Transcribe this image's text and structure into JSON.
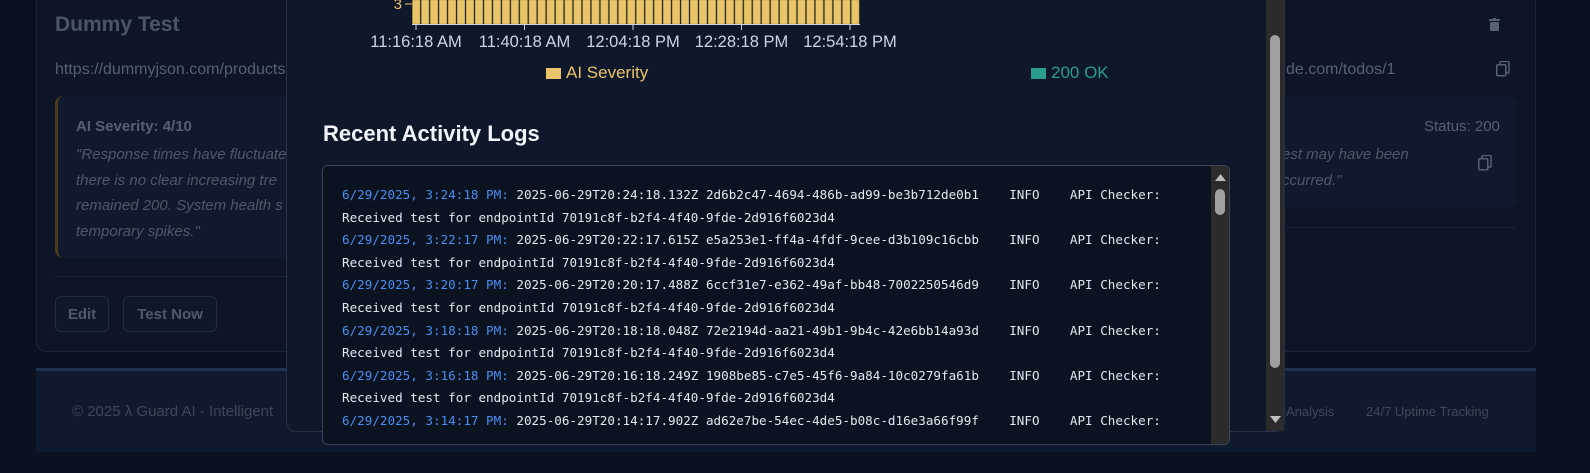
{
  "background": {
    "card_title": "Dummy Test",
    "url_left": "https://dummyjson.com/products",
    "url_right": "de.com/todos/1",
    "analysis_left": {
      "severity_label": "AI Severity: 4/10",
      "quote_lines": [
        "\"Response times have fluctuate",
        "there is no clear increasing tre",
        "remained 200. System health s",
        "temporary spikes.\""
      ]
    },
    "analysis_right": {
      "status_label": "Status: 200",
      "quote_lines": [
        "est may have been",
        "ccurred.\""
      ]
    },
    "buttons": {
      "edit": "Edit",
      "test_now": "Test Now"
    },
    "footer": {
      "left_text": "© 2025 λ Guard AI - Intelligent",
      "right_items": [
        "Analysis",
        "24/7 Uptime Tracking"
      ]
    }
  },
  "modal": {
    "chart_data": {
      "type": "bar",
      "x_tick_labels": [
        "11:16:18 AM",
        "11:40:18 AM",
        "12:04:18 PM",
        "12:28:18 PM",
        "12:54:18 PM"
      ],
      "y_visible_tick": "3",
      "series": [
        {
          "name": "AI Severity",
          "color": "#e9c46a",
          "bar_count": 50
        },
        {
          "name": "200 OK",
          "color": "#2a9d8f"
        }
      ],
      "legend": "bottom"
    },
    "logs_title": "Recent Activity Logs",
    "logs": [
      {
        "timestamp": "6/29/2025, 3:24:18 PM:",
        "iso": "2025-06-29T20:24:18.132Z",
        "id": "2d6b2c47-4694-486b-ad99-be3b712de0b1",
        "level": "INFO",
        "source": "API Checker:",
        "message": "Received test for endpointId 70191c8f-b2f4-4f40-9fde-2d916f6023d4"
      },
      {
        "timestamp": "6/29/2025, 3:22:17 PM:",
        "iso": "2025-06-29T20:22:17.615Z",
        "id": "e5a253e1-ff4a-4fdf-9cee-d3b109c16cbb",
        "level": "INFO",
        "source": "API Checker:",
        "message": "Received test for endpointId 70191c8f-b2f4-4f40-9fde-2d916f6023d4"
      },
      {
        "timestamp": "6/29/2025, 3:20:17 PM:",
        "iso": "2025-06-29T20:20:17.488Z",
        "id": "6ccf31e7-e362-49af-bb48-7002250546d9",
        "level": "INFO",
        "source": "API Checker:",
        "message": "Received test for endpointId 70191c8f-b2f4-4f40-9fde-2d916f6023d4"
      },
      {
        "timestamp": "6/29/2025, 3:18:18 PM:",
        "iso": "2025-06-29T20:18:18.048Z",
        "id": "72e2194d-aa21-49b1-9b4c-42e6bb14a93d",
        "level": "INFO",
        "source": "API Checker:",
        "message": "Received test for endpointId 70191c8f-b2f4-4f40-9fde-2d916f6023d4"
      },
      {
        "timestamp": "6/29/2025, 3:16:18 PM:",
        "iso": "2025-06-29T20:16:18.249Z",
        "id": "1908be85-c7e5-45f6-9a84-10c0279fa61b",
        "level": "INFO",
        "source": "API Checker:",
        "message": "Received test for endpointId 70191c8f-b2f4-4f40-9fde-2d916f6023d4"
      },
      {
        "timestamp": "6/29/2025, 3:14:17 PM:",
        "iso": "2025-06-29T20:14:17.902Z",
        "id": "ad62e7be-54ec-4de5-b08c-d16e3a66f99f",
        "level": "INFO",
        "source": "API Checker:",
        "message": ""
      }
    ]
  }
}
